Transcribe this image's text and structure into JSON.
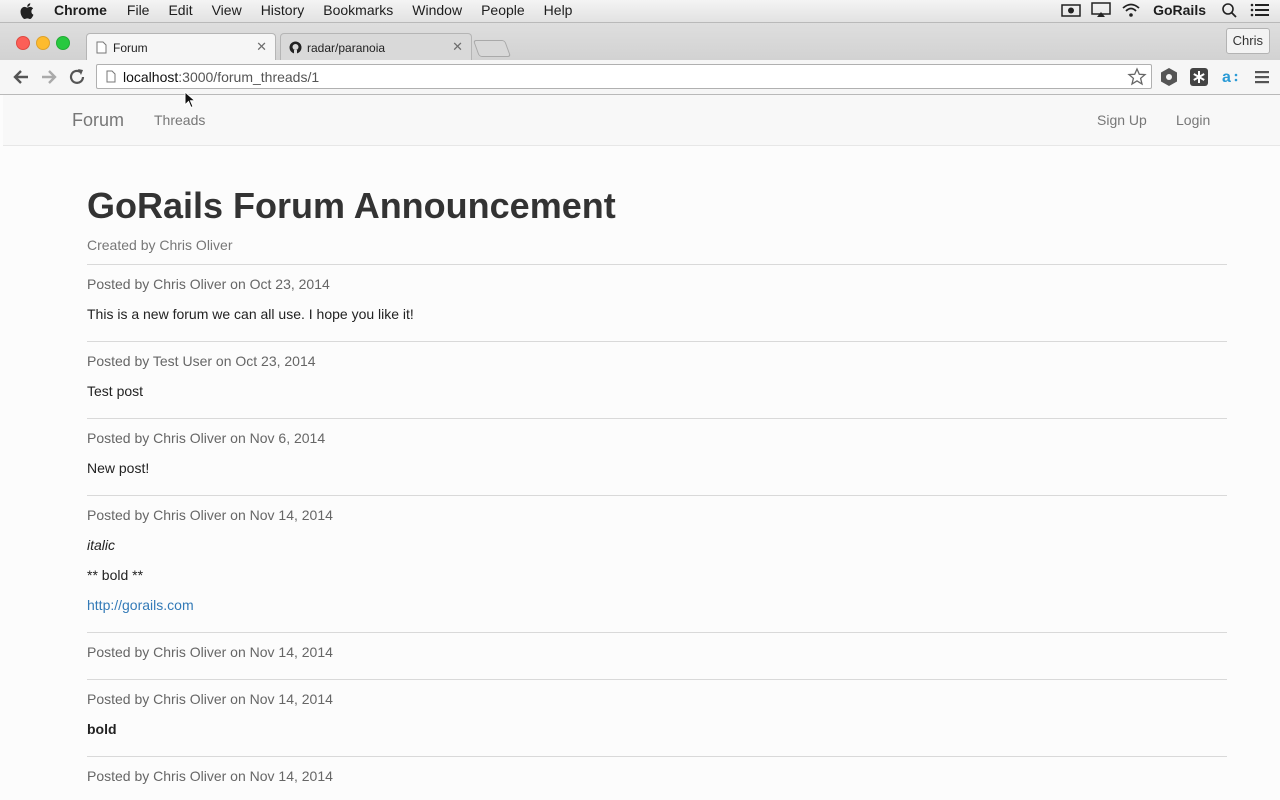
{
  "menubar": {
    "app": "Chrome",
    "items": [
      "File",
      "Edit",
      "View",
      "History",
      "Bookmarks",
      "Window",
      "People",
      "Help"
    ],
    "user": "GoRails"
  },
  "browser": {
    "tabs": [
      {
        "label": "Forum",
        "icon": "page-icon",
        "active": true
      },
      {
        "label": "radar/paranoia",
        "icon": "github-icon",
        "active": false
      }
    ],
    "profile": "Chris",
    "url_host": "localhost",
    "url_rest": ":3000/forum_threads/1"
  },
  "navbar": {
    "brand": "Forum",
    "threads": "Threads",
    "signup": "Sign Up",
    "login": "Login"
  },
  "thread": {
    "title": "GoRails Forum Announcement",
    "created_by": "Created by Chris Oliver",
    "posts": [
      {
        "meta": "Posted by Chris Oliver on Oct 23, 2014",
        "body": "This is a new forum we can all use. I hope you like it!"
      },
      {
        "meta": "Posted by Test User on Oct 23, 2014",
        "body": "Test post"
      },
      {
        "meta": "Posted by Chris Oliver on Nov 6, 2014",
        "body": "New post!"
      },
      {
        "meta": "Posted by Chris Oliver on Nov 14, 2014",
        "italic": "italic",
        "body2": "** bold **",
        "link": "http://gorails.com"
      },
      {
        "meta": "Posted by Chris Oliver on Nov 14, 2014"
      },
      {
        "meta": "Posted by Chris Oliver on Nov 14, 2014",
        "bold": "bold"
      },
      {
        "meta": "Posted by Chris Oliver on Nov 14, 2014"
      }
    ]
  },
  "colors": {
    "link": "#337ab7",
    "close": "#fc5f57",
    "minimize": "#fdbb2e",
    "maximize": "#28c940"
  }
}
